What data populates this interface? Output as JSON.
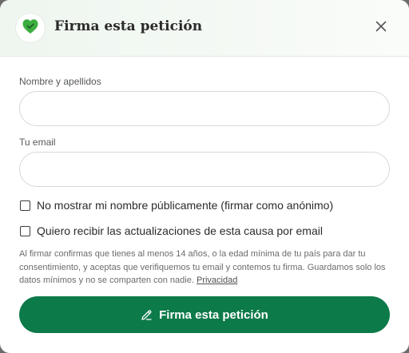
{
  "header": {
    "title": "Firma esta petición",
    "logo_icon": "heart-check-icon",
    "close_icon": "close-icon"
  },
  "form": {
    "name_label": "Nombre y apellidos",
    "name_value": "",
    "email_label": "Tu email",
    "email_value": "",
    "anonymous_label": "No mostrar mi nombre públicamente (firmar como anónimo)",
    "anonymous_checked": false,
    "updates_label": "Quiero recibir las actualizaciones de esta causa por email",
    "updates_checked": false,
    "disclaimer_text": "Al firmar confirmas que tienes al menos 14 años, o la edad mínima de tu país para dar tu consentimiento, y aceptas que verifiquemos tu email y contemos tu firma. Guardamos solo los datos mínimos y no se comparten con nadie.",
    "privacy_link": "Privacidad",
    "submit_label": "Firma esta petición",
    "submit_icon": "pencil-icon"
  },
  "colors": {
    "accent": "#0d7a4a",
    "logo_green": "#3cae3f"
  }
}
